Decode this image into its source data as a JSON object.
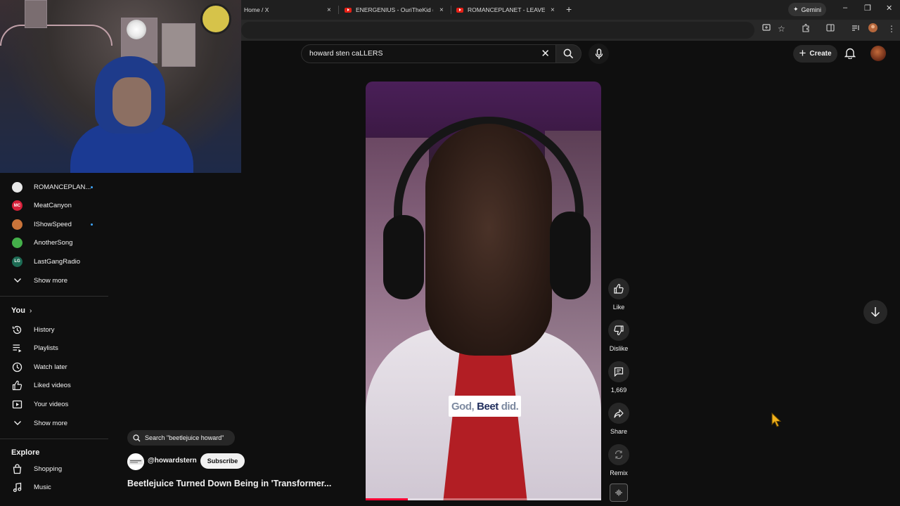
{
  "browser": {
    "tabs": [
      {
        "title": "Home / X",
        "close": "×"
      },
      {
        "title": "ENERGENIUS - OuriTheKid (Offi",
        "close": "×"
      },
      {
        "title": "ROMANCEPLANET - LEAVE TOI",
        "close": "×"
      }
    ],
    "new_tab": "+",
    "gemini_label": "Gemini",
    "window_controls": {
      "minimize": "–",
      "restore": "❐",
      "close": "✕"
    }
  },
  "header": {
    "search_value": "howard sten caLLERS",
    "clear": "✕",
    "create_label": "Create"
  },
  "sidebar": {
    "subscriptions": [
      {
        "name": "ROMANCEPLAN...",
        "new": true,
        "avatar_color": "#e8e8e8",
        "avatar_text": ""
      },
      {
        "name": "MeatCanyon",
        "new": false,
        "avatar_color": "#d6203a",
        "avatar_text": "MC"
      },
      {
        "name": "IShowSpeed",
        "new": true,
        "avatar_color": "#c9743a",
        "avatar_text": ""
      },
      {
        "name": "AnotherSong",
        "new": false,
        "avatar_color": "#44b04a",
        "avatar_text": ""
      },
      {
        "name": "LastGangRadio",
        "new": false,
        "avatar_color": "#1d6b54",
        "avatar_text": "LG"
      }
    ],
    "show_more_1": "Show more",
    "you_heading": "You",
    "you_items": [
      {
        "label": "History",
        "icon": "history-icon"
      },
      {
        "label": "Playlists",
        "icon": "playlists-icon"
      },
      {
        "label": "Watch later",
        "icon": "watch-later-icon"
      },
      {
        "label": "Liked videos",
        "icon": "liked-videos-icon"
      },
      {
        "label": "Your videos",
        "icon": "your-videos-icon"
      }
    ],
    "show_more_2": "Show more",
    "explore_heading": "Explore",
    "explore_items": [
      {
        "label": "Shopping",
        "icon": "shopping-icon"
      },
      {
        "label": "Music",
        "icon": "music-icon"
      }
    ]
  },
  "short": {
    "caption_prefix": "God,",
    "caption_highlight": "Beet",
    "caption_suffix": "did.",
    "progress": 0.18,
    "related_search": "Search \"beetlejuice howard\"",
    "channel_handle": "@howardstern",
    "subscribe_label": "Subscribe",
    "title": "Beetlejuice Turned Down Being in 'Transformer..."
  },
  "actions": {
    "like": "Like",
    "dislike": "Dislike",
    "comments": "1,669",
    "share": "Share",
    "remix": "Remix"
  }
}
